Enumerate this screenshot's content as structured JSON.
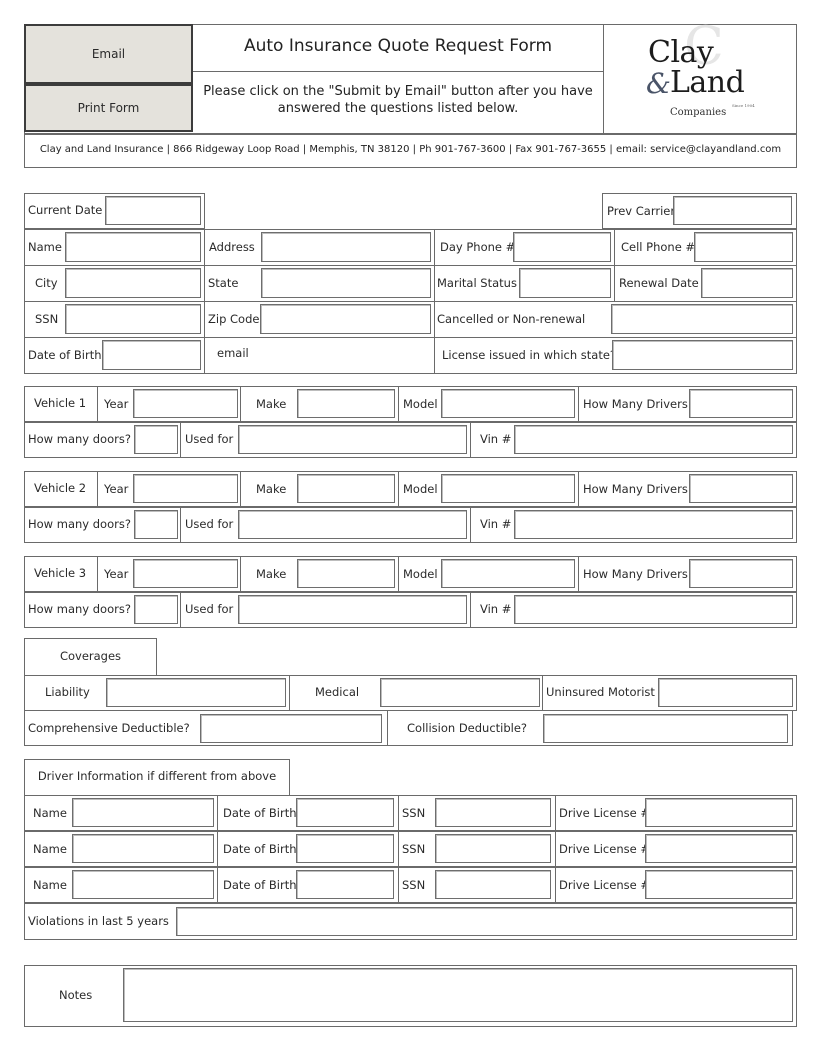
{
  "header": {
    "email_button": "Email",
    "print_button": "Print Form",
    "title": "Auto Insurance Quote Request Form",
    "instructions": "Please click on the \"Submit by Email\" button after you have answered the questions listed below.",
    "logo": {
      "line1": "Clay",
      "ampersand": "&",
      "line2": "Land",
      "since": "Since 1904",
      "companies": "Companies",
      "watermark": "C"
    },
    "address_line": "Clay and Land Insurance | 866 Ridgeway Loop Road | Memphis, TN 38120 | Ph 901-767-3600 | Fax 901-767-3655 | email: service@clayandland.com"
  },
  "applicant": {
    "current_date": "Current Date",
    "prev_carrier": "Prev Carrier",
    "name": "Name",
    "address": "Address",
    "day_phone": "Day Phone #",
    "cell_phone": "Cell Phone #",
    "city": "City",
    "state": "State",
    "marital_status": "Marital Status",
    "renewal_date": "Renewal Date",
    "ssn": "SSN",
    "zip_code": "Zip Code",
    "cancelled": "Cancelled or Non-renewal",
    "dob": "Date of Birth",
    "email": "email",
    "license_state": "License issued in which state?"
  },
  "vehicles": [
    {
      "title": "Vehicle 1",
      "year": "Year",
      "make": "Make",
      "model": "Model",
      "drivers": "How Many Drivers",
      "doors": "How many doors?",
      "used_for": "Used for",
      "vin": "Vin #"
    },
    {
      "title": "Vehicle 2",
      "year": "Year",
      "make": "Make",
      "model": "Model",
      "drivers": "How Many Drivers",
      "doors": "How many doors?",
      "used_for": "Used for",
      "vin": "Vin #"
    },
    {
      "title": "Vehicle 3",
      "year": "Year",
      "make": "Make",
      "model": "Model",
      "drivers": "How Many Drivers",
      "doors": "How many doors?",
      "used_for": "Used for",
      "vin": "Vin #"
    }
  ],
  "coverages": {
    "title": "Coverages",
    "liability": "Liability",
    "medical": "Medical",
    "uninsured": "Uninsured Motorist",
    "comprehensive": "Comprehensive Deductible?",
    "collision": "Collision Deductible?"
  },
  "drivers": {
    "title": "Driver Information if different from above",
    "rows": [
      {
        "name": "Name",
        "dob": "Date of Birth",
        "ssn": "SSN",
        "license": "Drive License #"
      },
      {
        "name": "Name",
        "dob": "Date of Birth",
        "ssn": "SSN",
        "license": "Drive License #"
      },
      {
        "name": "Name",
        "dob": "Date of Birth",
        "ssn": "SSN",
        "license": "Drive License #"
      }
    ],
    "violations": "Violations in last 5 years"
  },
  "notes": {
    "label": "Notes"
  }
}
